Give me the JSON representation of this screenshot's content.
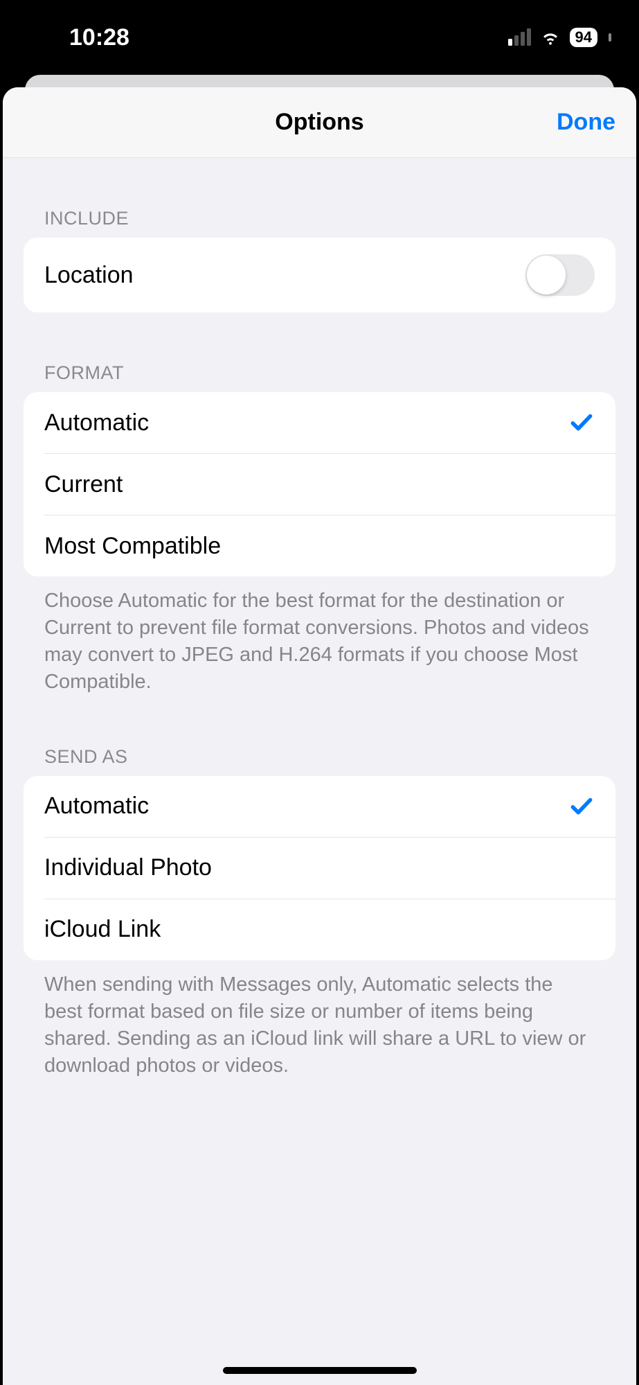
{
  "status_bar": {
    "time": "10:28",
    "battery": "94"
  },
  "sheet": {
    "title": "Options",
    "done_label": "Done"
  },
  "sections": {
    "include": {
      "header": "Include",
      "location_label": "Location",
      "location_on": false
    },
    "format": {
      "header": "Format",
      "options": [
        {
          "label": "Automatic",
          "selected": true
        },
        {
          "label": "Current",
          "selected": false
        },
        {
          "label": "Most Compatible",
          "selected": false
        }
      ],
      "footer": "Choose Automatic for the best format for the destination or Current to prevent file format conversions. Photos and videos may convert to JPEG and H.264 formats if you choose Most Compatible."
    },
    "send_as": {
      "header": "Send As",
      "options": [
        {
          "label": "Automatic",
          "selected": true
        },
        {
          "label": "Individual Photo",
          "selected": false
        },
        {
          "label": "iCloud Link",
          "selected": false
        }
      ],
      "footer": "When sending with Messages only, Automatic selects the best format based on file size or number of items being shared. Sending as an iCloud link will share a URL to view or download photos or videos."
    }
  }
}
